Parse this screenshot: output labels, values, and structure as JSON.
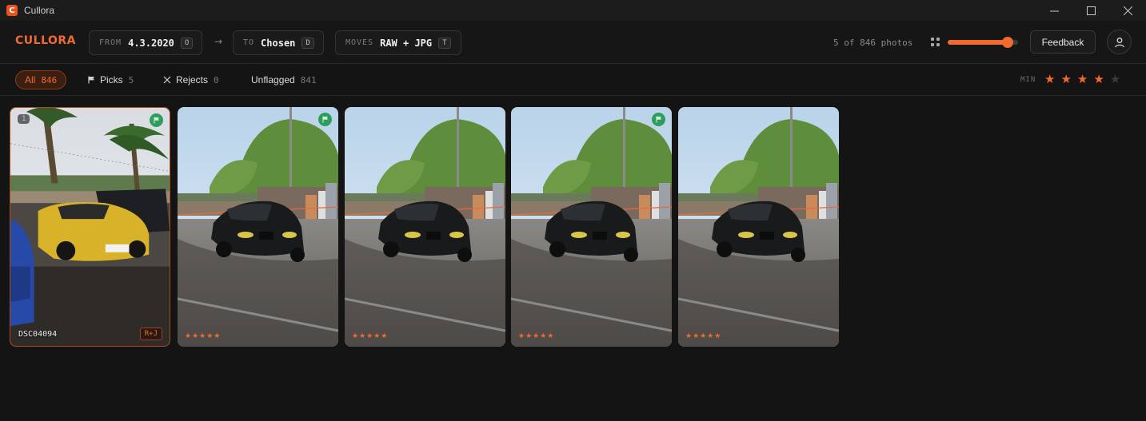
{
  "window": {
    "title": "Cullora",
    "app_icon_letter": "C"
  },
  "toolbar": {
    "logo": "CULLORA",
    "from": {
      "label": "FROM",
      "value": "4.3.2020",
      "key": "O"
    },
    "to": {
      "label": "TO",
      "value": "Chosen",
      "key": "D"
    },
    "moves": {
      "label": "MOVES",
      "value": "RAW + JPG",
      "key": "T"
    },
    "arrow": "→",
    "photo_count": "5 of 846 photos",
    "thumb_size": 0.85,
    "feedback_label": "Feedback"
  },
  "filters": {
    "tabs": [
      {
        "label": "All",
        "count": "846",
        "active": true
      },
      {
        "label": "Picks",
        "count": "5",
        "icon": "flag-icon"
      },
      {
        "label": "Rejects",
        "count": "0",
        "icon": "x-icon"
      },
      {
        "label": "Unflagged",
        "count": "841"
      }
    ],
    "min_label": "MIN",
    "min_rating": 4,
    "max_rating": 5
  },
  "photos": [
    {
      "index": "1",
      "name": "DSC04094",
      "badge": "R+J",
      "flagged": true,
      "selected": true,
      "scene": "palms"
    },
    {
      "stars": "★★★★★",
      "flagged": true,
      "scene": "bmw"
    },
    {
      "stars": "★★★★★",
      "flagged": false,
      "scene": "bmw"
    },
    {
      "stars": "★★★★★",
      "flagged": true,
      "scene": "bmw"
    },
    {
      "stars": "★★★★★",
      "flagged": false,
      "scene": "bmw"
    }
  ],
  "colors": {
    "accent": "#f26a2e",
    "flag": "#2f9e5c",
    "background": "#141414"
  }
}
